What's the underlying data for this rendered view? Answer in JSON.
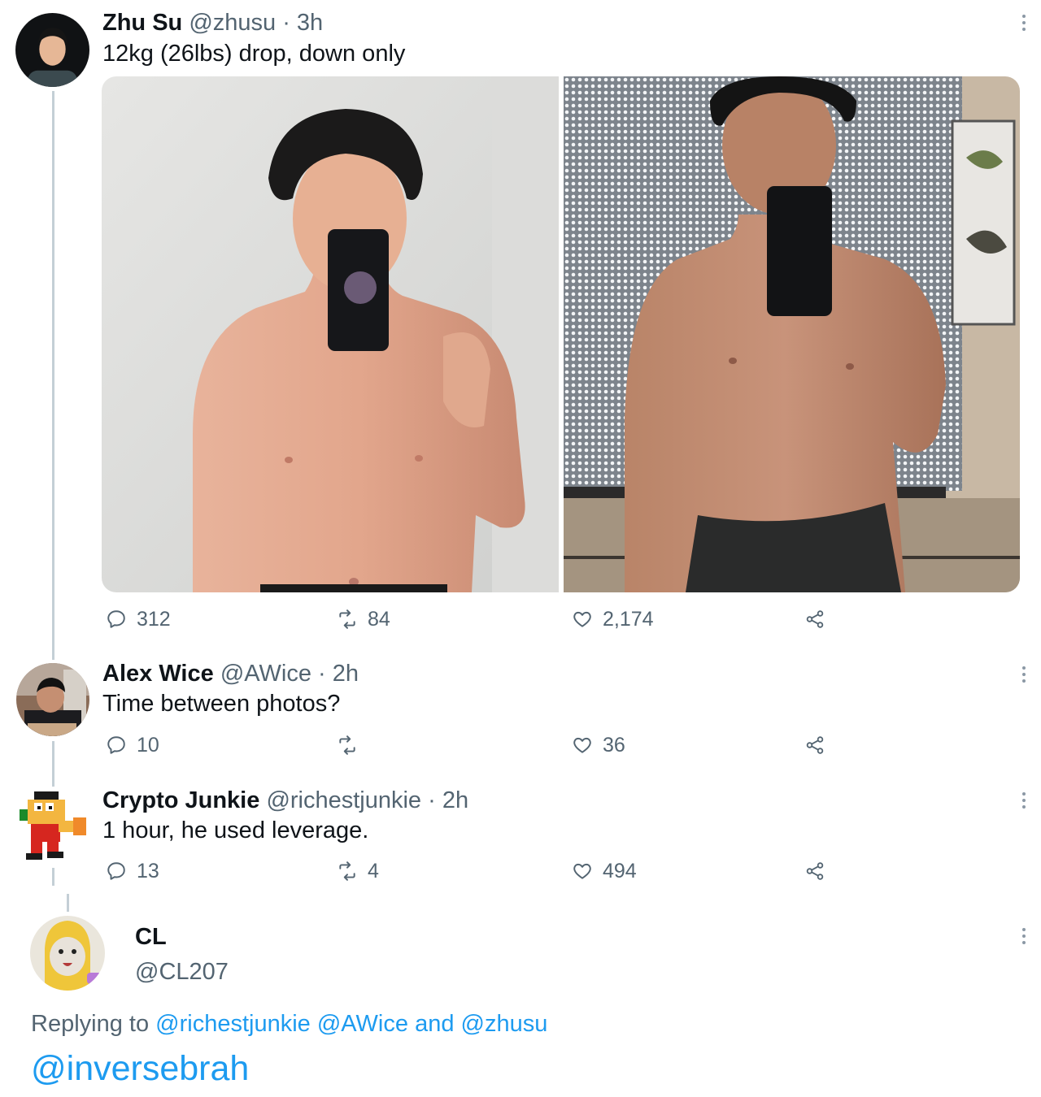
{
  "colors": {
    "text_primary": "#0f1419",
    "text_secondary": "#536471",
    "link": "#1d9bf0",
    "thread_line": "#c4cfd6"
  },
  "tweets": [
    {
      "name": "Zhu Su",
      "handle": "@zhusu",
      "time": "· 3h",
      "text": "12kg (26lbs) drop, down only",
      "actions": {
        "replies": "312",
        "retweets": "84",
        "likes": "2,174"
      },
      "media": [
        "before-photo",
        "after-photo"
      ]
    },
    {
      "name": "Alex Wice",
      "handle": "@AWice",
      "time": "· 2h",
      "text": "Time between photos?",
      "actions": {
        "replies": "10",
        "retweets": "",
        "likes": "36"
      }
    },
    {
      "name": "Crypto Junkie",
      "handle": "@richestjunkie",
      "time": "· 2h",
      "text": "1 hour, he used leverage.",
      "actions": {
        "replies": "13",
        "retweets": "4",
        "likes": "494"
      }
    }
  ],
  "focused_tweet": {
    "name": "CL",
    "handle": "@CL207",
    "replying_prefix": "Replying to",
    "replying_to": [
      "@richestjunkie",
      "@AWice",
      "@zhusu"
    ],
    "replying_joiner": "and",
    "text": "@inversebrah"
  },
  "icons": {
    "reply": "speech-bubble-icon",
    "retweet": "retweet-arrows-icon",
    "like": "heart-icon",
    "share": "share-nodes-icon",
    "more": "vertical-dots-icon"
  }
}
